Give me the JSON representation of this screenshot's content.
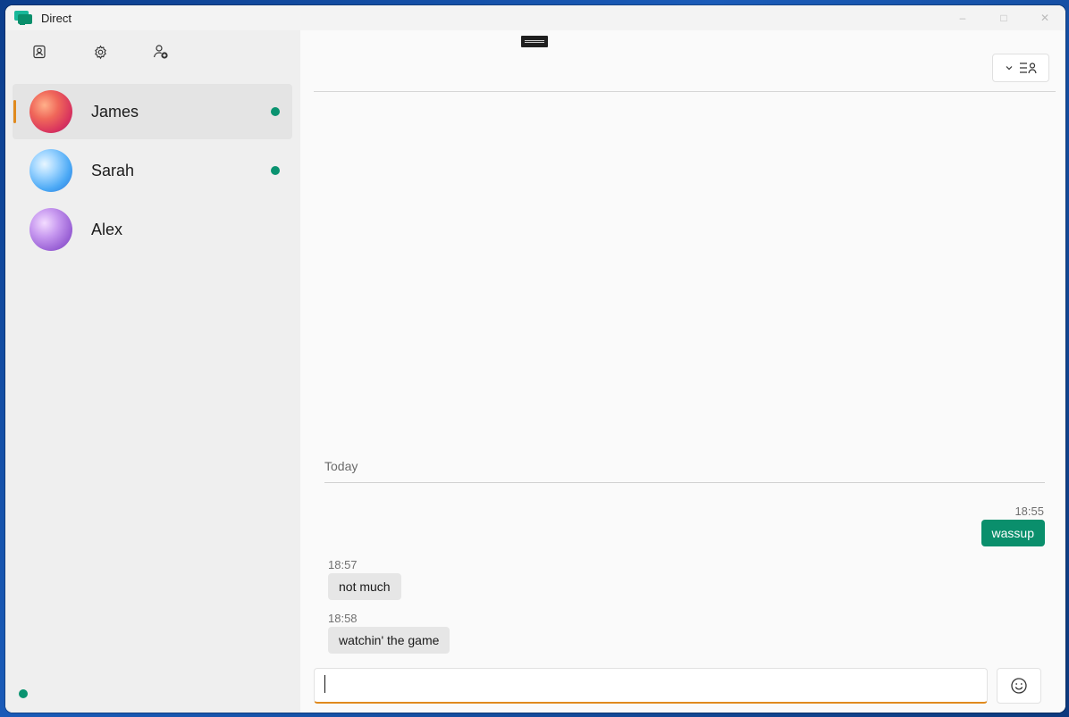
{
  "window": {
    "title": "Direct",
    "controls": {
      "minimize": "–",
      "maximize": "□",
      "close": "✕"
    }
  },
  "sidebar": {
    "contacts": [
      {
        "name": "James",
        "online": true,
        "selected": true
      },
      {
        "name": "Sarah",
        "online": true,
        "selected": false
      },
      {
        "name": "Alex",
        "online": false,
        "selected": false
      }
    ]
  },
  "chat": {
    "day_label": "Today",
    "messages": [
      {
        "time": "18:55",
        "text": "wassup",
        "direction": "outgoing"
      },
      {
        "time": "18:57",
        "text": "not much",
        "direction": "incoming"
      },
      {
        "time": "18:58",
        "text": "watchin' the game",
        "direction": "incoming"
      }
    ],
    "composer_value": ""
  },
  "colors": {
    "accent": "#e08a1e",
    "online": "#0a9370",
    "outgoing_bubble": "#0a8f6c",
    "incoming_bubble": "#e6e6e6"
  },
  "icons": [
    "app-logo-icon",
    "contact-card-icon",
    "gear-icon",
    "add-user-icon",
    "chevron-down-icon",
    "people-list-icon",
    "emoji-icon"
  ]
}
